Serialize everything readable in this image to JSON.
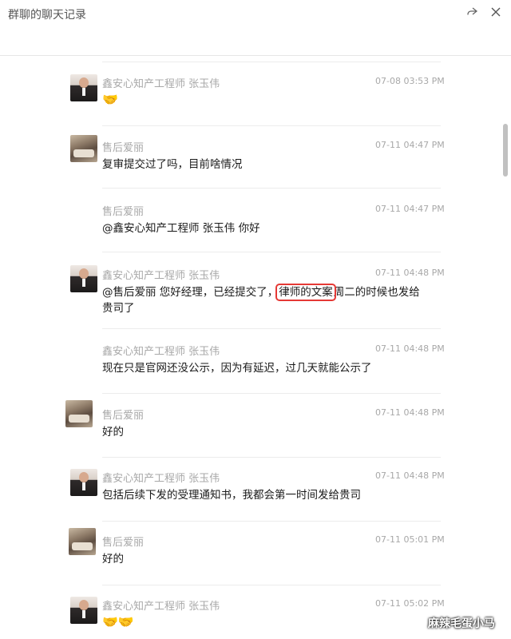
{
  "window": {
    "title": "群聊的聊天记录",
    "share_icon": "share-icon",
    "close_icon": "close-icon"
  },
  "messages": [
    {
      "sender": "鑫安心知产工程师 张玉伟",
      "time": "07-08 03:53 PM",
      "text": "🤝",
      "avatar": "engineer-avatar"
    },
    {
      "sender": "售后爱丽",
      "time": "07-11 04:47 PM",
      "text": "复审提交过了吗，目前啥情况",
      "avatar": "aili-avatar"
    },
    {
      "sender": "售后爱丽",
      "time": "07-11 04:47 PM",
      "text": "@鑫安心知产工程师 张玉伟 你好"
    },
    {
      "sender": "鑫安心知产工程师 张玉伟",
      "time": "07-11 04:48 PM",
      "text_before": "@售后爱丽 您好经理，已经提交了，",
      "text_highlight": "律师的文案",
      "text_after": "周二的时候也发给贵司了",
      "avatar": "engineer-avatar"
    },
    {
      "sender": "鑫安心知产工程师 张玉伟",
      "time": "07-11 04:48 PM",
      "text": "现在只是官网还没公示，因为有延迟，过几天就能公示了"
    },
    {
      "sender": "售后爱丽",
      "time": "07-11 04:48 PM",
      "text": "好的",
      "avatar": "aili-avatar"
    },
    {
      "sender": "鑫安心知产工程师 张玉伟",
      "time": "07-11 04:48 PM",
      "text": "包括后续下发的受理通知书，我都会第一时间发给贵司",
      "avatar": "engineer-avatar"
    },
    {
      "sender": "售后爱丽",
      "time": "07-11 05:01 PM",
      "text": "好的",
      "avatar": "aili-avatar"
    },
    {
      "sender": "鑫安心知产工程师 张玉伟",
      "time": "07-11 05:02 PM",
      "text": "🤝🤝",
      "avatar": "engineer-avatar"
    }
  ],
  "watermark": "麻辣毛蛋小马"
}
